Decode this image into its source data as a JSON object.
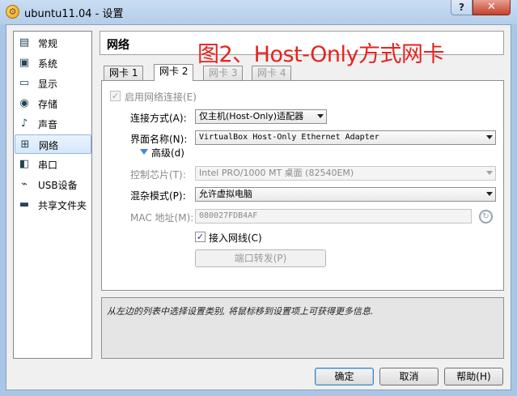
{
  "window": {
    "title": "ubuntu11.04 - 设置",
    "help_label": "?",
    "close_label": "✕"
  },
  "sidebar": {
    "items": [
      {
        "label": "常规",
        "icon": "general-icon",
        "glyph": "▤"
      },
      {
        "label": "系统",
        "icon": "system-icon",
        "glyph": "▣"
      },
      {
        "label": "显示",
        "icon": "display-icon",
        "glyph": "▭"
      },
      {
        "label": "存储",
        "icon": "storage-icon",
        "glyph": "◉"
      },
      {
        "label": "声音",
        "icon": "audio-icon",
        "glyph": "♪"
      },
      {
        "label": "网络",
        "icon": "network-icon",
        "glyph": "⊞"
      },
      {
        "label": "串口",
        "icon": "serial-port-icon",
        "glyph": "◧"
      },
      {
        "label": "USB设备",
        "icon": "usb-icon",
        "glyph": "⌁"
      },
      {
        "label": "共享文件夹",
        "icon": "shared-folder-icon",
        "glyph": "▬"
      }
    ],
    "selected_index": 5
  },
  "page": {
    "header": "网络",
    "overlay_title": "图2、Host-Only方式网卡"
  },
  "tabs": [
    {
      "label": "网卡 1",
      "state": "normal"
    },
    {
      "label": "网卡 2",
      "state": "active"
    },
    {
      "label": "网卡 3",
      "state": "disabled"
    },
    {
      "label": "网卡 4",
      "state": "disabled"
    }
  ],
  "form": {
    "enable_adapter": {
      "label": "启用网络连接(E)",
      "checked": true,
      "check_glyph": "✓"
    },
    "attached_to": {
      "label": "连接方式(A):",
      "value": "仅主机(Host-Only)适配器"
    },
    "name": {
      "label": "界面名称(N):",
      "value": "VirtualBox Host-Only Ethernet Adapter"
    },
    "advanced": {
      "label": "高级(d)"
    },
    "adapter_type": {
      "label": "控制芯片(T):",
      "value": "Intel PRO/1000 MT 桌面 (82540EM)"
    },
    "promiscuous": {
      "label": "混杂模式(P):",
      "value": "允许虚拟电脑"
    },
    "mac": {
      "label": "MAC 地址(M):",
      "value": "080027FDB4AF",
      "refresh_glyph": "↻"
    },
    "cable_connected": {
      "label": "接入网线(C)",
      "checked": true,
      "check_glyph": "✓"
    },
    "port_forwarding": {
      "label": "端口转发(P)"
    }
  },
  "info": {
    "text": "从左边的列表中选择设置类别, 将鼠标移到设置项上可获得更多信息."
  },
  "buttons": {
    "ok": "确定",
    "cancel": "取消",
    "help": "帮助(H)"
  }
}
